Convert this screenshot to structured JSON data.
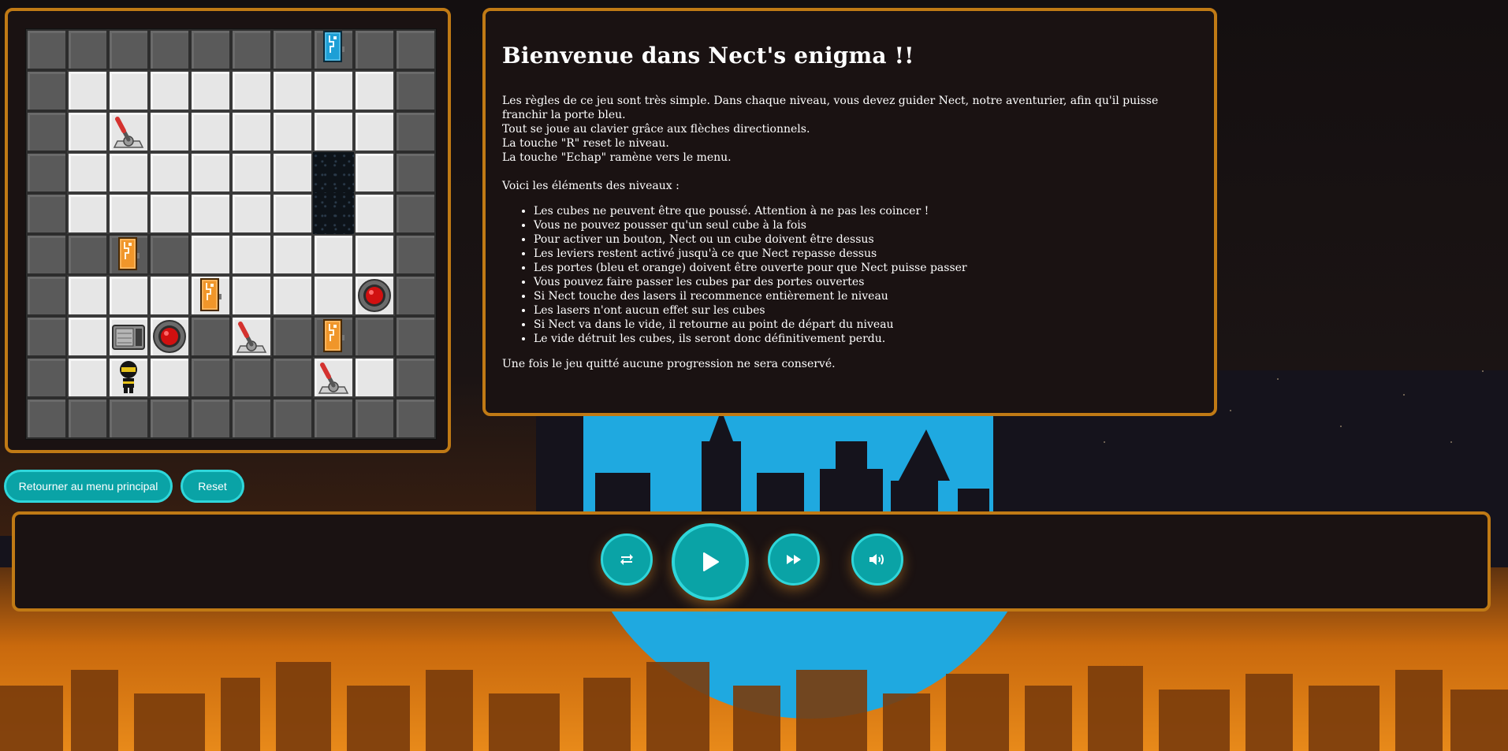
{
  "rules": {
    "title": "Bienvenue dans Nect's enigma !!",
    "intro": [
      "Les règles de ce jeu sont très simple. Dans chaque niveau, vous devez guider Nect, notre aventurier, afin qu'il puisse franchir la porte bleu.",
      "Tout se joue au clavier grâce aux flèches directionnels.",
      "La touche \"R\" reset le niveau.",
      "La touche \"Echap\" ramène vers le menu."
    ],
    "elements_heading": "Voici les éléments des niveaux :",
    "elements": [
      "Les cubes ne peuvent être que poussé. Attention à ne pas les coincer !",
      "Vous ne pouvez pousser qu'un seul cube à la fois",
      "Pour activer un bouton, Nect ou un cube doivent être dessus",
      "Les leviers restent activé jusqu'à ce que Nect repasse dessus",
      "Les portes (bleu et orange) doivent être ouverte pour que Nect puisse passer",
      "Vous pouvez faire passer les cubes par des portes ouvertes",
      "Si Nect touche des lasers il recommence entièrement le niveau",
      "Les lasers n'ont aucun effet sur les cubes",
      "Si Nect va dans le vide, il retourne au point de départ du niveau",
      "Le vide détruit les cubes, ils seront donc définitivement perdu."
    ],
    "footer": "Une fois le jeu quitté aucune progression ne sera conservé."
  },
  "buttons": {
    "menu": "Retourner au menu principal",
    "reset": "Reset"
  },
  "player": {
    "controls": [
      {
        "name": "repeat-icon"
      },
      {
        "name": "play-icon"
      },
      {
        "name": "fast-forward-icon"
      },
      {
        "name": "volume-icon"
      }
    ]
  },
  "colors": {
    "panel_border": "#c07a15",
    "panel_bg": "#1a1212",
    "button": "#0aa3a6",
    "button_border": "#2fd6da",
    "door_blue": "#1d9fd6",
    "door_orange": "#f0962a"
  },
  "level": {
    "legend": {
      "W": "wall",
      "F": "floor",
      "V": "void"
    },
    "rows": [
      "WWWWWWWWWW",
      "WFFFFFFFFW",
      "WFFFFFFFFW",
      "WFFFFFFVFW",
      "WFFFFFFVFW",
      "WWWWFFFFFW",
      "WFFFFFFFFW",
      "WFFFWFWWWW",
      "WFFFWWWFFW",
      "WWWWWWWWWW"
    ],
    "objects": [
      {
        "type": "door-blue",
        "row": 0,
        "col": 7
      },
      {
        "type": "lever",
        "row": 2,
        "col": 2
      },
      {
        "type": "door-orange",
        "row": 5,
        "col": 2
      },
      {
        "type": "door-orange",
        "row": 6,
        "col": 4
      },
      {
        "type": "button",
        "row": 6,
        "col": 8
      },
      {
        "type": "cube",
        "row": 7,
        "col": 2
      },
      {
        "type": "button",
        "row": 7,
        "col": 3
      },
      {
        "type": "lever",
        "row": 7,
        "col": 5
      },
      {
        "type": "door-orange",
        "row": 7,
        "col": 7
      },
      {
        "type": "player",
        "row": 8,
        "col": 2
      },
      {
        "type": "lever",
        "row": 8,
        "col": 7
      }
    ]
  }
}
